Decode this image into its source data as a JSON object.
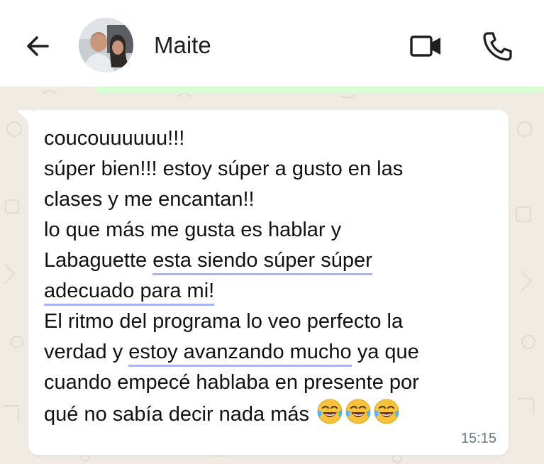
{
  "header": {
    "back_icon": "arrow-left-icon",
    "contact_name": "Maite",
    "video_icon": "video-camera-icon",
    "call_icon": "phone-icon"
  },
  "message": {
    "line1": "coucouuuuuu!!!",
    "line2": "súper bien!!! estoy súper a gusto en las",
    "line3": "clases y me encantan!!",
    "line4": "lo que más me gusta es hablar y",
    "line5_a": "Labaguette ",
    "line5_b": "esta siendo súper súper",
    "line6_b": "adecuado para mi!",
    "line7": "El ritmo del programa lo veo perfecto la",
    "line8_a": "verdad y ",
    "line8_b": "estoy avanzando mucho",
    "line8_c": " ya que",
    "line9": "cuando empecé hablaba en presente por",
    "line10": "qué no sabía decir nada más",
    "emoji_icon": "face-with-tears-of-joy-icon",
    "time": "15:15"
  },
  "colors": {
    "chat_background": "#efeae2",
    "incoming_bubble": "#ffffff",
    "outgoing_bubble": "#d9fdd3",
    "spellcheck_underline": "#a9b4f2",
    "timestamp": "#667781"
  }
}
